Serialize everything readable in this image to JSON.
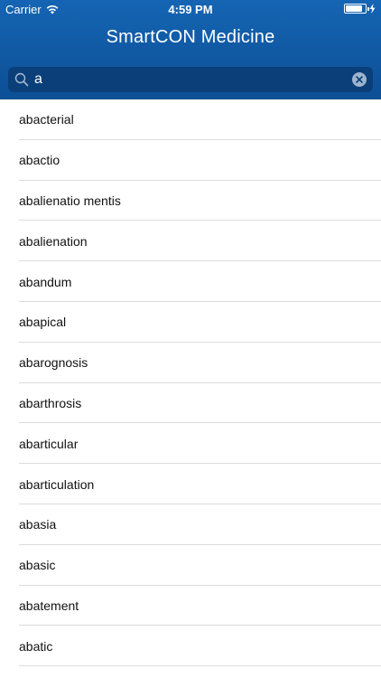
{
  "status_bar": {
    "carrier": "Carrier",
    "time": "4:59 PM",
    "battery_level": 0.85
  },
  "header": {
    "title": "SmartCON Medicine"
  },
  "search": {
    "value": "a",
    "search_icon": "search-icon",
    "clear_icon": "clear-icon"
  },
  "colors": {
    "header_top": "#1565b4",
    "header_bottom": "#0c4f95",
    "search_field": "#0a3f7a",
    "separator": "#dcdcdc"
  },
  "results": [
    "abacterial",
    "abactio",
    "abalienatio mentis",
    "abalienation",
    "abandum",
    "abapical",
    "abarognosis",
    "abarthrosis",
    "abarticular",
    "abarticulation",
    "abasia",
    "abasic",
    "abatement",
    "abatic"
  ]
}
